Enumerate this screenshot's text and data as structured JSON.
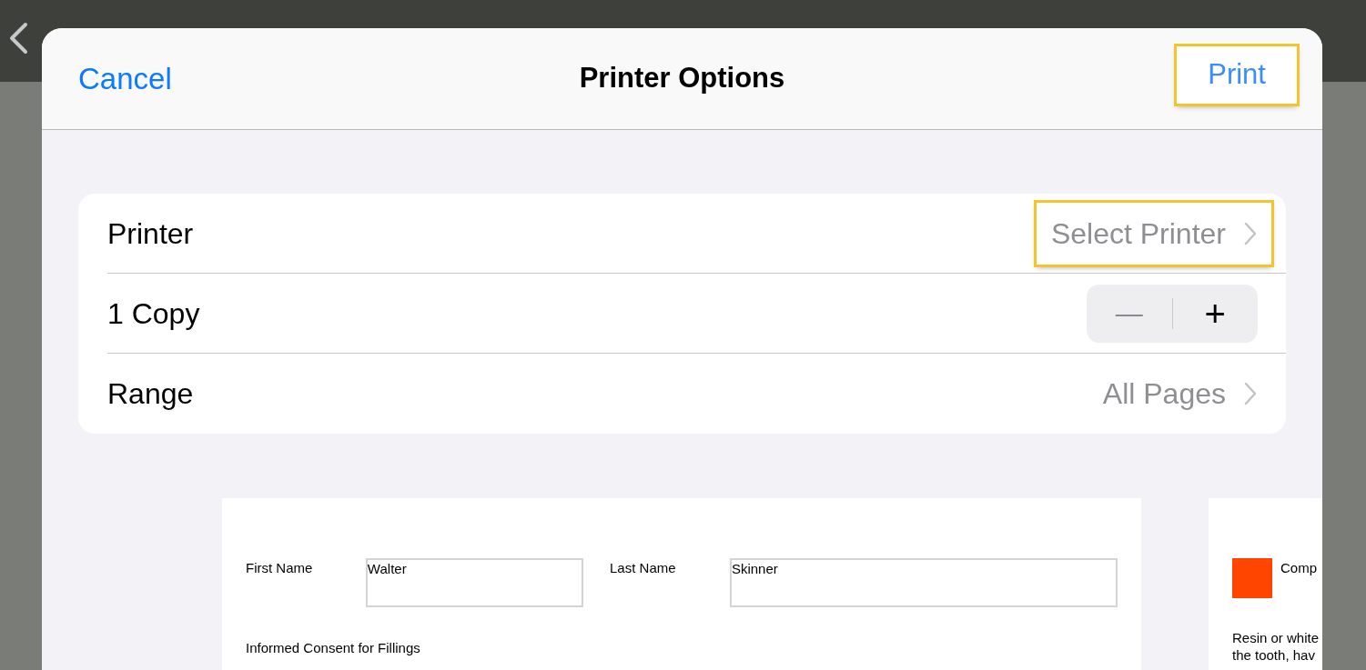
{
  "dialog": {
    "title": "Printer Options",
    "cancel": "Cancel",
    "print": {
      "label": "Print",
      "highlighted": true
    }
  },
  "options": [
    {
      "kind": "link",
      "label": "Printer",
      "value": "Select Printer",
      "highlighted": true
    },
    {
      "kind": "stepper",
      "label": "1 Copy",
      "minus": "—",
      "plus": "+"
    },
    {
      "kind": "link",
      "label": "Range",
      "value": "All Pages",
      "highlighted": false
    }
  ],
  "preview": {
    "page_1": {
      "first_name_label": "First Name",
      "first_name": "Walter",
      "last_name_label": "Last Name",
      "last_name": "Skinner",
      "heading": "Informed Consent for Fillings"
    },
    "page_2": {
      "label": "Comp",
      "lines": [
        "Resin or white",
        "the tooth, hav"
      ]
    }
  }
}
